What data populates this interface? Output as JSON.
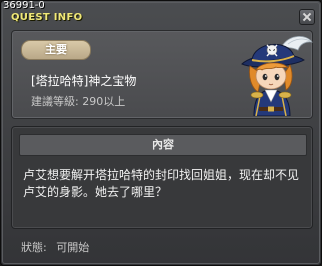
{
  "window": {
    "id_label": "36991-0",
    "title": "QUEST INFO"
  },
  "quest": {
    "category": "主要",
    "name": "[塔拉哈特]神之宝物",
    "level_text": "建議等級: 290以上",
    "portrait_icon": "pirate-captain-portrait-icon"
  },
  "content": {
    "header": "內容",
    "text": "卢艾想要解开塔拉哈特的封印找回姐姐，现在却不见卢艾的身影。她去了哪里？"
  },
  "status": {
    "label": "狀態:",
    "value": "可開始"
  },
  "colors": {
    "title": "#f0e878",
    "badge": "#c9b898"
  }
}
